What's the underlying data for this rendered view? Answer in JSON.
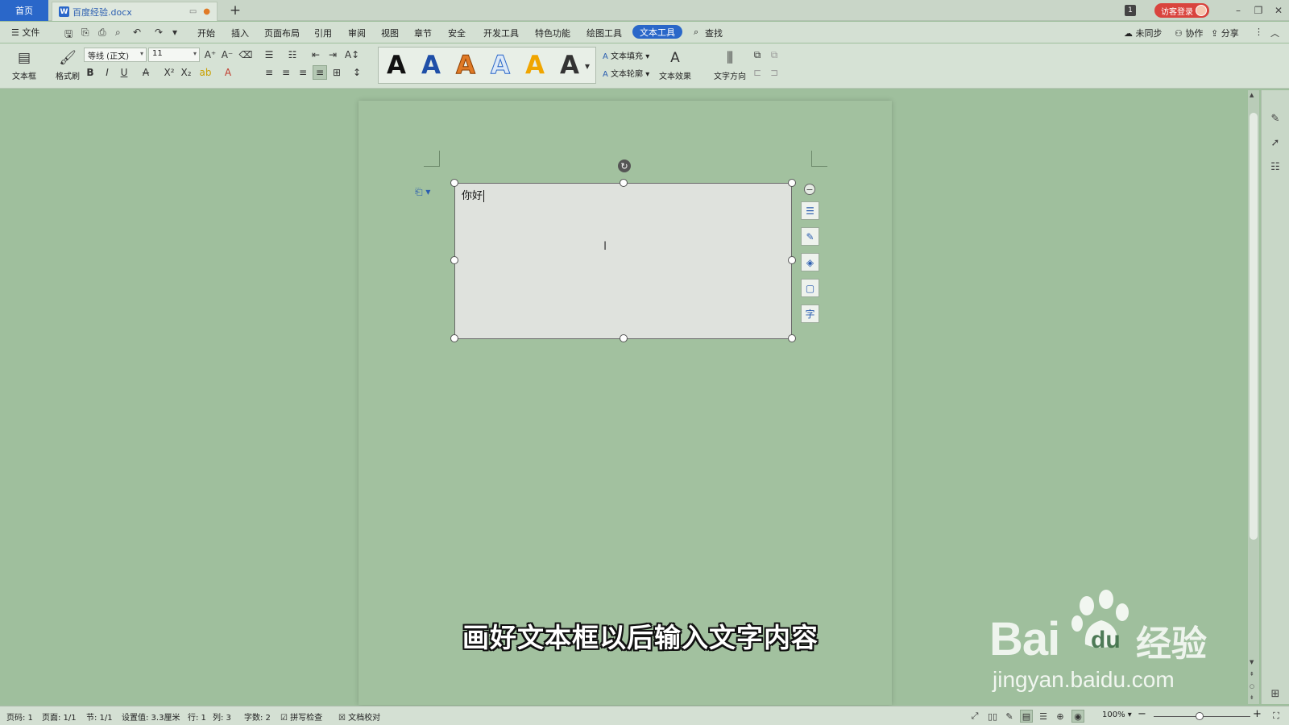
{
  "tabs": {
    "home": "首页",
    "doc_title": "百度经验.docx",
    "add": "+"
  },
  "titlebar": {
    "badge": "1",
    "visitor_login": "访客登录",
    "minimize": "–",
    "restore": "❐",
    "close": "✕"
  },
  "menu": {
    "file": "☰ 文件",
    "items": [
      "开始",
      "插入",
      "页面布局",
      "引用",
      "审阅",
      "视图",
      "章节",
      "安全",
      "开发工具",
      "特色功能",
      "绘图工具"
    ],
    "active": "文本工具",
    "search": "查找",
    "unsynced": "未同步",
    "collab": "协作",
    "share": "分享"
  },
  "ribbon": {
    "textbox_label": "文本框",
    "format_painter_label": "格式刷",
    "font_name": "等线 (正文)",
    "font_size": "11",
    "text_fill": "文本填充",
    "text_outline": "文本轮廓",
    "text_effect": "文本效果",
    "text_direction": "文字方向",
    "style_letters": [
      "A",
      "A",
      "A",
      "A",
      "A",
      "A"
    ]
  },
  "document": {
    "textbox_content": "你好",
    "subtitle": "画好文本框以后输入文字内容",
    "side_tool_char": "字"
  },
  "watermark": {
    "brand": "Bai",
    "du": "du",
    "jingyan": "经验",
    "url": "jingyan.baidu.com"
  },
  "status": {
    "page_num": "页码: 1",
    "pages": "页面: 1/1",
    "section": "节: 1/1",
    "setting": "设置值: 3.3厘米",
    "row": "行: 1",
    "col": "列: 3",
    "word_count": "字数: 2",
    "spell_check": "拼写检查",
    "doc_check": "文档校对",
    "zoom": "100%"
  }
}
